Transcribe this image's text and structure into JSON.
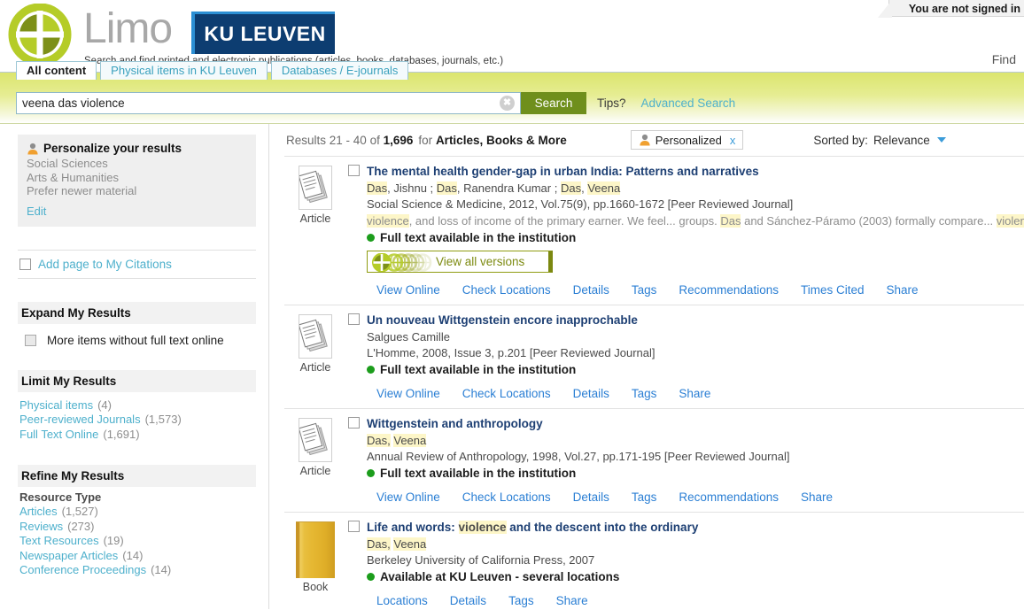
{
  "header": {
    "signed_in_notice": "You are not signed in",
    "brand_word": "Limo",
    "ku_logo_text": "KU LEUVEN",
    "tagline": "Search and find printed and electronic publications (articles, books, databases, journals, etc.)",
    "find_label": "Find"
  },
  "search": {
    "tabs": [
      {
        "label": "All content",
        "active": true
      },
      {
        "label": "Physical items in KU Leuven",
        "active": false
      },
      {
        "label": "Databases / E-journals",
        "active": false
      }
    ],
    "query_value": "veena das violence",
    "placeholder": "",
    "clear_glyph": "✖",
    "search_button": "Search",
    "tips_label": "Tips?",
    "advanced_search_label": "Advanced Search"
  },
  "sidebar": {
    "personalize": {
      "title": "Personalize your results",
      "lines": [
        "Social Sciences",
        "Arts & Humanities",
        "Prefer newer material"
      ],
      "edit_label": "Edit"
    },
    "citations": {
      "label": "Add page to My Citations"
    },
    "expand": {
      "heading": "Expand My Results",
      "option_label": "More items without full text online"
    },
    "limit": {
      "heading": "Limit My Results",
      "items": [
        {
          "label": "Physical items",
          "count": "(4)"
        },
        {
          "label": "Peer-reviewed Journals",
          "count": "(1,573)"
        },
        {
          "label": "Full Text Online",
          "count": "(1,691)"
        }
      ]
    },
    "refine": {
      "heading": "Refine My Results",
      "group_title": "Resource Type",
      "items": [
        {
          "label": "Articles",
          "count": "(1,527)"
        },
        {
          "label": "Reviews",
          "count": "(273)"
        },
        {
          "label": "Text Resources",
          "count": "(19)"
        },
        {
          "label": "Newspaper Articles",
          "count": "(14)"
        },
        {
          "label": "Conference Proceedings",
          "count": "(14)"
        }
      ]
    }
  },
  "results_header": {
    "range_prefix": "Results",
    "range": "21 - 40",
    "of_label": "of",
    "total": "1,696",
    "for_label": "for",
    "scope": "Articles, Books & More",
    "personalized_chip": "Personalized",
    "chip_close": "x",
    "sorted_by_label": "Sorted by:",
    "sort_value": "Relevance"
  },
  "results": [
    {
      "type_caption": "Article",
      "icon": "article-pages-icon",
      "title_parts": [
        {
          "text": "The mental health gender-gap in urban India: Patterns and narratives",
          "hl": false
        }
      ],
      "authors_parts": [
        {
          "text": "Das",
          "hl": true
        },
        {
          "text": ", Jishnu ; ",
          "hl": false
        },
        {
          "text": "Das",
          "hl": true
        },
        {
          "text": ", Ranendra Kumar ; ",
          "hl": false
        },
        {
          "text": "Das",
          "hl": true
        },
        {
          "text": ", ",
          "hl": false
        },
        {
          "text": "Veena",
          "hl": true
        }
      ],
      "meta": "Social Science & Medicine, 2012, Vol.75(9), pp.1660-1672 [Peer Reviewed Journal]",
      "snippet_parts": [
        {
          "text": "violence",
          "hl": true
        },
        {
          "text": ", and loss of income of the primary earner. We feel... groups. ",
          "hl": false
        },
        {
          "text": "Das",
          "hl": true
        },
        {
          "text": " and Sánchez-Páramo (2003) formally compare... ",
          "hl": false
        },
        {
          "text": "violence",
          "hl": true
        }
      ],
      "availability": "Full text available in the institution",
      "versions_button": "View all versions",
      "links": [
        "View Online",
        "Check Locations",
        "Details",
        "Tags",
        "Recommendations",
        "Times Cited",
        "Share"
      ]
    },
    {
      "type_caption": "Article",
      "icon": "article-pages-icon",
      "title_parts": [
        {
          "text": "Un nouveau Wittgenstein encore inapprochable",
          "hl": false
        }
      ],
      "authors_parts": [
        {
          "text": "Salgues Camille",
          "hl": false
        }
      ],
      "meta": "L'Homme, 2008, Issue 3, p.201 [Peer Reviewed Journal]",
      "snippet_parts": [],
      "availability": "Full text available in the institution",
      "versions_button": "",
      "links": [
        "View Online",
        "Check Locations",
        "Details",
        "Tags",
        "Share"
      ]
    },
    {
      "type_caption": "Article",
      "icon": "article-pages-icon",
      "title_parts": [
        {
          "text": "Wittgenstein and anthropology",
          "hl": false
        }
      ],
      "authors_parts": [
        {
          "text": "Das,",
          "hl": true
        },
        {
          "text": " ",
          "hl": false
        },
        {
          "text": "Veena",
          "hl": true
        }
      ],
      "meta": "Annual Review of Anthropology, 1998, Vol.27, pp.171-195 [Peer Reviewed Journal]",
      "snippet_parts": [],
      "availability": "Full text available in the institution",
      "versions_button": "",
      "links": [
        "View Online",
        "Check Locations",
        "Details",
        "Tags",
        "Recommendations",
        "Share"
      ]
    },
    {
      "type_caption": "Book",
      "icon": "book-cover-icon",
      "title_parts": [
        {
          "text": "Life and words: ",
          "hl": false
        },
        {
          "text": "violence",
          "hl": true
        },
        {
          "text": " and the descent into the ordinary",
          "hl": false
        }
      ],
      "authors_parts": [
        {
          "text": "Das,",
          "hl": true
        },
        {
          "text": " ",
          "hl": false
        },
        {
          "text": "Veena",
          "hl": true
        }
      ],
      "meta": "Berkeley University of California Press, 2007",
      "snippet_parts": [],
      "availability": "Available at KU Leuven - several locations",
      "versions_button": "",
      "links": [
        "Locations",
        "Details",
        "Tags",
        "Share"
      ]
    }
  ],
  "colors": {
    "brand_green": "#b5cc28",
    "search_button": "#6f8f1c",
    "link_blue": "#2b7fd4",
    "facet_teal": "#4eb0cc",
    "highlight_yellow": "#fdf6c8",
    "ku_navy": "#0d3d71",
    "available_green": "#1c9d1c"
  }
}
